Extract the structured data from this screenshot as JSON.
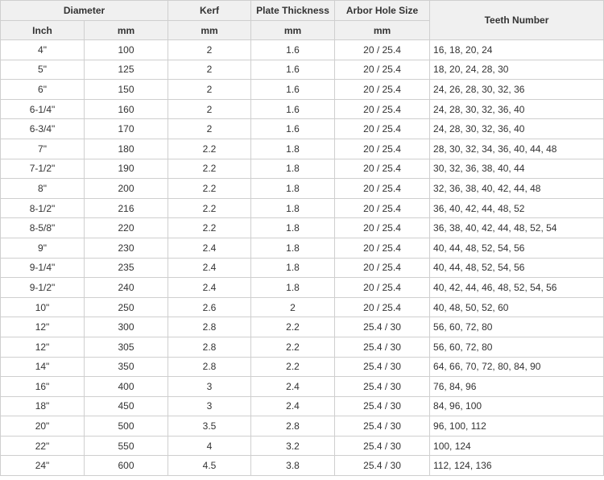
{
  "headers": {
    "diameter": "Diameter",
    "kerf": "Kerf",
    "plate_thickness": "Plate Thickness",
    "arbor_hole_size": "Arbor Hole Size",
    "teeth_number": "Teeth Number",
    "inch": "Inch",
    "mm_diameter": "mm",
    "mm_kerf": "mm",
    "mm_plate": "mm",
    "mm_arbor": "mm"
  },
  "rows": [
    {
      "inch": "4\"",
      "mm": "100",
      "kerf": "2",
      "plate": "1.6",
      "arbor": "20 / 25.4",
      "teeth": "16, 18, 20, 24"
    },
    {
      "inch": "5\"",
      "mm": "125",
      "kerf": "2",
      "plate": "1.6",
      "arbor": "20 / 25.4",
      "teeth": "18, 20, 24, 28, 30"
    },
    {
      "inch": "6\"",
      "mm": "150",
      "kerf": "2",
      "plate": "1.6",
      "arbor": "20 / 25.4",
      "teeth": "24, 26, 28, 30, 32, 36"
    },
    {
      "inch": "6-1/4\"",
      "mm": "160",
      "kerf": "2",
      "plate": "1.6",
      "arbor": "20 / 25.4",
      "teeth": "24, 28, 30, 32, 36, 40"
    },
    {
      "inch": "6-3/4\"",
      "mm": "170",
      "kerf": "2",
      "plate": "1.6",
      "arbor": "20 / 25.4",
      "teeth": "24, 28, 30, 32, 36, 40"
    },
    {
      "inch": "7\"",
      "mm": "180",
      "kerf": "2.2",
      "plate": "1.8",
      "arbor": "20 / 25.4",
      "teeth": "28, 30, 32, 34, 36, 40, 44, 48"
    },
    {
      "inch": "7-1/2\"",
      "mm": "190",
      "kerf": "2.2",
      "plate": "1.8",
      "arbor": "20 / 25.4",
      "teeth": "30, 32, 36, 38, 40, 44"
    },
    {
      "inch": "8\"",
      "mm": "200",
      "kerf": "2.2",
      "plate": "1.8",
      "arbor": "20 / 25.4",
      "teeth": "32, 36, 38, 40, 42, 44, 48"
    },
    {
      "inch": "8-1/2\"",
      "mm": "216",
      "kerf": "2.2",
      "plate": "1.8",
      "arbor": "20 / 25.4",
      "teeth": "36, 40, 42, 44, 48, 52"
    },
    {
      "inch": "8-5/8\"",
      "mm": "220",
      "kerf": "2.2",
      "plate": "1.8",
      "arbor": "20 / 25.4",
      "teeth": "36, 38, 40, 42, 44, 48, 52, 54"
    },
    {
      "inch": "9\"",
      "mm": "230",
      "kerf": "2.4",
      "plate": "1.8",
      "arbor": "20 / 25.4",
      "teeth": "40, 44, 48, 52, 54, 56"
    },
    {
      "inch": "9-1/4\"",
      "mm": "235",
      "kerf": "2.4",
      "plate": "1.8",
      "arbor": "20 / 25.4",
      "teeth": "40, 44, 48, 52, 54, 56"
    },
    {
      "inch": "9-1/2\"",
      "mm": "240",
      "kerf": "2.4",
      "plate": "1.8",
      "arbor": "20 / 25.4",
      "teeth": "40, 42, 44, 46, 48, 52, 54, 56"
    },
    {
      "inch": "10\"",
      "mm": "250",
      "kerf": "2.6",
      "plate": "2",
      "arbor": "20 / 25.4",
      "teeth": "40, 48, 50, 52, 60"
    },
    {
      "inch": "12\"",
      "mm": "300",
      "kerf": "2.8",
      "plate": "2.2",
      "arbor": "25.4 / 30",
      "teeth": "56, 60, 72, 80"
    },
    {
      "inch": "12\"",
      "mm": "305",
      "kerf": "2.8",
      "plate": "2.2",
      "arbor": "25.4 / 30",
      "teeth": "56, 60, 72, 80"
    },
    {
      "inch": "14\"",
      "mm": "350",
      "kerf": "2.8",
      "plate": "2.2",
      "arbor": "25.4 / 30",
      "teeth": "64, 66, 70, 72, 80, 84, 90"
    },
    {
      "inch": "16\"",
      "mm": "400",
      "kerf": "3",
      "plate": "2.4",
      "arbor": "25.4 / 30",
      "teeth": "76, 84, 96"
    },
    {
      "inch": "18\"",
      "mm": "450",
      "kerf": "3",
      "plate": "2.4",
      "arbor": "25.4 / 30",
      "teeth": "84, 96, 100"
    },
    {
      "inch": "20\"",
      "mm": "500",
      "kerf": "3.5",
      "plate": "2.8",
      "arbor": "25.4 / 30",
      "teeth": "96, 100, 112"
    },
    {
      "inch": "22\"",
      "mm": "550",
      "kerf": "4",
      "plate": "3.2",
      "arbor": "25.4 / 30",
      "teeth": "100, 124"
    },
    {
      "inch": "24\"",
      "mm": "600",
      "kerf": "4.5",
      "plate": "3.8",
      "arbor": "25.4 / 30",
      "teeth": "112, 124, 136"
    }
  ],
  "colors": {
    "header_bg": "#f0f0f0",
    "border": "#cfcfcf",
    "text": "#333333"
  }
}
